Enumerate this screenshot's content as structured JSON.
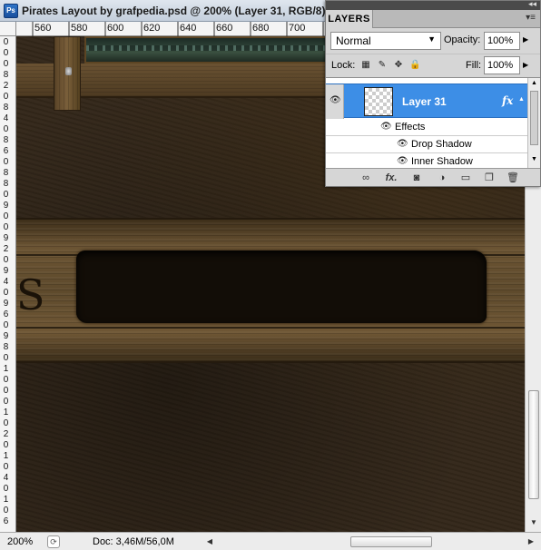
{
  "document": {
    "app_icon": "ps-app-icon",
    "app_icon_text": "Ps",
    "title": "Pirates Layout by grafpedia.psd @ 200% (Layer 31, RGB/8)"
  },
  "ruler_top": {
    "labels": [
      "560",
      "580",
      "600",
      "620",
      "640",
      "660",
      "680",
      "700"
    ]
  },
  "ruler_left": {
    "digits": [
      "0",
      "0",
      "0",
      "8",
      "2",
      "0",
      "8",
      "4",
      "0",
      "8",
      "6",
      "0",
      "8",
      "8",
      "0",
      "9",
      "0",
      "0",
      "9",
      "2",
      "0",
      "9",
      "4",
      "0",
      "9",
      "6",
      "0",
      "9",
      "8",
      "0",
      "1",
      "0",
      "0",
      "0",
      "1",
      "0",
      "2",
      "0",
      "1",
      "0",
      "4",
      "0",
      "1",
      "0",
      "6"
    ]
  },
  "canvas": {
    "sign_letter": "S"
  },
  "status": {
    "zoom": "200%",
    "doc_size": "Doc: 3,46M/56,0M"
  },
  "layers_panel": {
    "tab_label": "LAYERS",
    "blend_mode": "Normal",
    "opacity_label": "Opacity:",
    "opacity_value": "100%",
    "lock_label": "Lock:",
    "fill_label": "Fill:",
    "fill_value": "100%",
    "selected_layer": {
      "name": "Layer 31",
      "fx": "fx"
    },
    "effects_label": "Effects",
    "effects": [
      "Drop Shadow",
      "Inner Shadow"
    ],
    "icons": {
      "eye": "eye-icon",
      "link": "link-icon",
      "fx": "fx-icon",
      "mask": "mask-icon",
      "adjustment": "adjustment-icon",
      "folder": "folder-icon",
      "new_layer": "new-layer-icon",
      "trash": "trash-icon"
    }
  }
}
